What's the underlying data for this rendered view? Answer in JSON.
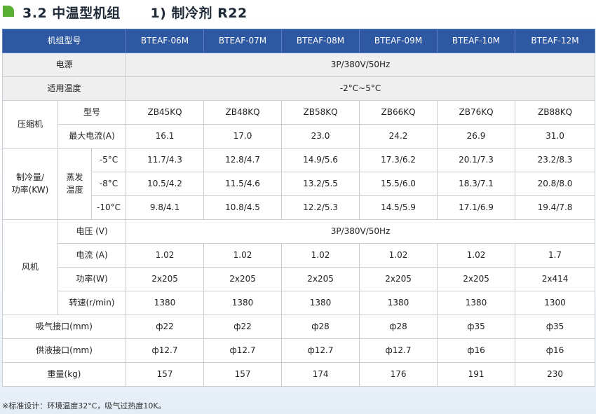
{
  "header": {
    "title": "3.2 中温型机组      1) 制冷剂 R22"
  },
  "table": {
    "model_label": "机组型号",
    "models": [
      "BTEAF-06M",
      "BTEAF-07M",
      "BTEAF-08M",
      "BTEAF-09M",
      "BTEAF-10M",
      "BTEAF-12M"
    ],
    "power_label": "电源",
    "power_value": "3P/380V/50Hz",
    "temp_label": "适用温度",
    "temp_value": "-2°C~5°C",
    "compressor": {
      "label": "压缩机",
      "model_label": "型号",
      "models": [
        "ZB45KQ",
        "ZB48KQ",
        "ZB58KQ",
        "ZB66KQ",
        "ZB76KQ",
        "ZB88KQ"
      ],
      "current_label": "最大电流(A)",
      "currents": [
        "16.1",
        "17.0",
        "23.0",
        "24.2",
        "26.9",
        "31.0"
      ]
    },
    "cooling": {
      "label_line1": "制冷量/",
      "label_line2": "功率(KW)",
      "evap_line1": "蒸发",
      "evap_line2": "温度",
      "rows": [
        {
          "temp": "-5°C",
          "values": [
            "11.7/4.3",
            "12.8/4.7",
            "14.9/5.6",
            "17.3/6.2",
            "20.1/7.3",
            "23.2/8.3"
          ]
        },
        {
          "temp": "-8°C",
          "values": [
            "10.5/4.2",
            "11.5/4.6",
            "13.2/5.5",
            "15.5/6.0",
            "18.3/7.1",
            "20.8/8.0"
          ]
        },
        {
          "temp": "-10°C",
          "values": [
            "9.8/4.1",
            "10.8/4.5",
            "12.2/5.3",
            "14.5/5.9",
            "17.1/6.9",
            "19.4/7.8"
          ]
        }
      ]
    },
    "fan": {
      "label": "风机",
      "voltage_label": "电压 (V)",
      "voltage_value": "3P/380V/50Hz",
      "current_label": "电流 (A)",
      "currents": [
        "1.02",
        "1.02",
        "1.02",
        "1.02",
        "1.02",
        "1.7"
      ],
      "power_label": "功率(W)",
      "powers": [
        "2x205",
        "2x205",
        "2x205",
        "2x205",
        "2x205",
        "2x414"
      ],
      "speed_label": "转速(r/min)",
      "speeds": [
        "1380",
        "1380",
        "1380",
        "1380",
        "1380",
        "1300"
      ]
    },
    "suction_label": "吸气接口(mm)",
    "suction": [
      "ф22",
      "ф22",
      "ф28",
      "ф28",
      "ф35",
      "ф35"
    ],
    "liquid_label": "供液接口(mm)",
    "liquid": [
      "ф12.7",
      "ф12.7",
      "ф12.7",
      "ф12.7",
      "ф16",
      "ф16"
    ],
    "weight_label": "重量(kg)",
    "weights": [
      "157",
      "157",
      "174",
      "176",
      "191",
      "230"
    ]
  },
  "footnote": "※标准设计：环境温度32°C，吸气过热度10K。"
}
